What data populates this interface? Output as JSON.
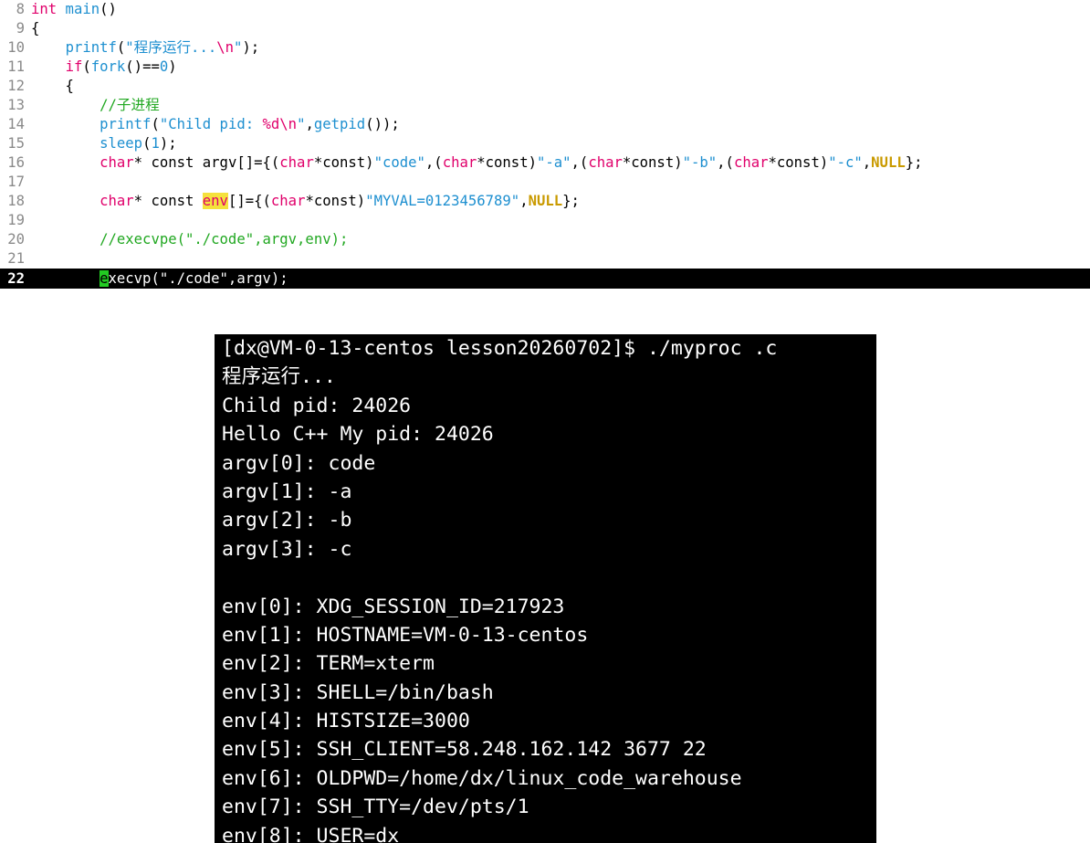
{
  "editor": {
    "lines": [
      {
        "no": "8",
        "parts": [
          [
            "kw",
            "int"
          ],
          [
            "",
            ""
          ],
          [
            "fn",
            " main"
          ],
          [
            "",
            "()"
          ]
        ]
      },
      {
        "no": "9",
        "parts": [
          [
            "",
            "{"
          ]
        ]
      },
      {
        "no": "10",
        "parts": [
          [
            "",
            "    "
          ],
          [
            "fn",
            "printf"
          ],
          [
            "",
            "("
          ],
          [
            "str",
            "\"程序运行..."
          ],
          [
            "esc",
            "\\n"
          ],
          [
            "str",
            "\""
          ],
          [
            "",
            ");"
          ]
        ]
      },
      {
        "no": "11",
        "parts": [
          [
            "",
            "    "
          ],
          [
            "kw",
            "if"
          ],
          [
            "",
            "("
          ],
          [
            "fn",
            "fork"
          ],
          [
            "",
            "()=="
          ],
          [
            "num",
            "0"
          ],
          [
            "",
            ")"
          ]
        ]
      },
      {
        "no": "12",
        "parts": [
          [
            "",
            "    {"
          ]
        ]
      },
      {
        "no": "13",
        "parts": [
          [
            "",
            "        "
          ],
          [
            "cmt",
            "//子进程"
          ]
        ]
      },
      {
        "no": "14",
        "parts": [
          [
            "",
            "        "
          ],
          [
            "fn",
            "printf"
          ],
          [
            "",
            "("
          ],
          [
            "str",
            "\"Child pid: "
          ],
          [
            "esc",
            "%d\\n"
          ],
          [
            "str",
            "\""
          ],
          [
            "",
            ","
          ],
          [
            "fn",
            "getpid"
          ],
          [
            "",
            "());"
          ]
        ]
      },
      {
        "no": "15",
        "parts": [
          [
            "",
            "        "
          ],
          [
            "fn",
            "sleep"
          ],
          [
            "",
            "("
          ],
          [
            "num",
            "1"
          ],
          [
            "",
            ");"
          ]
        ]
      },
      {
        "no": "16",
        "parts": [
          [
            "",
            "        "
          ],
          [
            "type",
            "char"
          ],
          [
            "",
            "* const argv[]={("
          ],
          [
            "type",
            "char"
          ],
          [
            "",
            "*const)"
          ],
          [
            "str",
            "\"code\""
          ],
          [
            "",
            ",("
          ],
          [
            "type",
            "char"
          ],
          [
            "",
            "*const)"
          ],
          [
            "str",
            "\"-a\""
          ],
          [
            "",
            ",("
          ],
          [
            "type",
            "char"
          ],
          [
            "",
            "*const)"
          ],
          [
            "str",
            "\"-b\""
          ],
          [
            "",
            ",("
          ],
          [
            "type",
            "char"
          ],
          [
            "",
            "*const)"
          ],
          [
            "str",
            "\"-c\""
          ],
          [
            "",
            ","
          ],
          [
            "null",
            "NULL"
          ],
          [
            "",
            "};"
          ]
        ]
      },
      {
        "no": "17",
        "parts": []
      },
      {
        "no": "18",
        "parts": [
          [
            "",
            "        "
          ],
          [
            "type",
            "char"
          ],
          [
            "",
            "* const "
          ],
          [
            "hl",
            "env"
          ],
          [
            "",
            "[]={("
          ],
          [
            "type",
            "char"
          ],
          [
            "",
            "*const)"
          ],
          [
            "str",
            "\"MYVAL=0123456789\""
          ],
          [
            "",
            ","
          ],
          [
            "null",
            "NULL"
          ],
          [
            "",
            "};"
          ]
        ]
      },
      {
        "no": "19",
        "parts": []
      },
      {
        "no": "20",
        "parts": [
          [
            "",
            "        "
          ],
          [
            "cmt",
            "//execvpe(\"./code\",argv,env);"
          ]
        ]
      },
      {
        "no": "21",
        "parts": []
      },
      {
        "no": "22",
        "current": true,
        "parts": [
          [
            "",
            "        "
          ],
          [
            "cursor",
            "e"
          ],
          [
            "",
            "xecvp(\"./code\",argv);"
          ]
        ]
      }
    ]
  },
  "terminal": {
    "lines": [
      "[dx@VM-0-13-centos lesson20260702]$ ./myproc .c",
      "程序运行...",
      "Child pid: 24026",
      "Hello C++ My pid: 24026",
      "argv[0]: code",
      "argv[1]: -a",
      "argv[2]: -b",
      "argv[3]: -c",
      "",
      "env[0]: XDG_SESSION_ID=217923",
      "env[1]: HOSTNAME=VM-0-13-centos",
      "env[2]: TERM=xterm",
      "env[3]: SHELL=/bin/bash",
      "env[4]: HISTSIZE=3000",
      "env[5]: SSH_CLIENT=58.248.162.142 3677 22",
      "env[6]: OLDPWD=/home/dx/linux_code_warehouse",
      "env[7]: SSH_TTY=/dev/pts/1",
      "env[8]: USER=dx"
    ]
  }
}
